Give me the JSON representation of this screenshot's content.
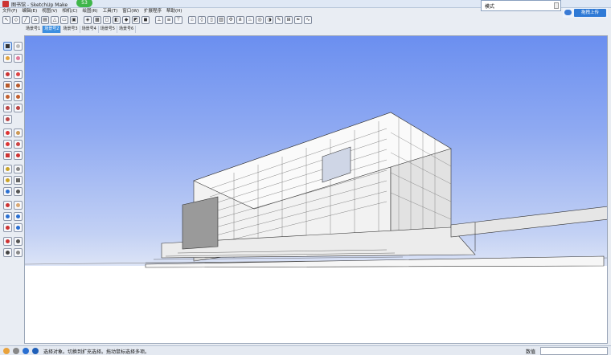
{
  "window": {
    "title": "图书馆 - SketchUp Make",
    "badge": "53"
  },
  "menubar": {
    "items": [
      "文件(F)",
      "编辑(E)",
      "视图(V)",
      "相机(C)",
      "绘图(R)",
      "工具(T)",
      "窗口(W)",
      "扩展程序",
      "帮助(H)"
    ]
  },
  "tray": {
    "text": "模式"
  },
  "upload_button": "拖拽上传",
  "scene_tabs": {
    "items": [
      "场景号1",
      "场景号2",
      "场景号3",
      "场景号4",
      "场景号5",
      "场景号6"
    ],
    "active_index": 1
  },
  "statusbar": {
    "hint": "选择对象。切换到扩充选择。拖动鼠标选择多项。",
    "measure_label": "数值"
  },
  "colors": {
    "sky_top": "#6b8ff0",
    "ground": "#ffffff",
    "active_tab": "#3d8fe0"
  }
}
